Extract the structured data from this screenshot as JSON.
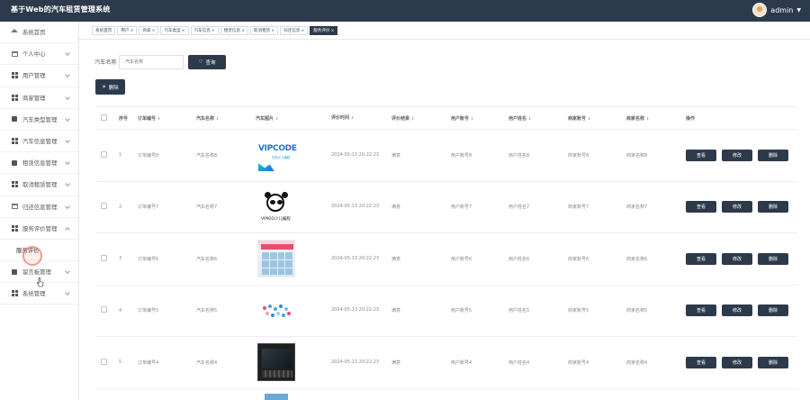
{
  "app": {
    "title": "基于Web的汽车租赁管理系统",
    "user": "admin"
  },
  "sidebar": {
    "items": [
      {
        "label": "系统首页",
        "icon": "home-icon"
      },
      {
        "label": "个人中心",
        "icon": "calendar-icon"
      },
      {
        "label": "用户管理",
        "icon": "grid-icon"
      },
      {
        "label": "商家管理",
        "icon": "grid-icon"
      },
      {
        "label": "汽车类型管理",
        "icon": "bag-icon"
      },
      {
        "label": "汽车信息管理",
        "icon": "grid-icon"
      },
      {
        "label": "租赁信息管理",
        "icon": "car-icon"
      },
      {
        "label": "取消租赁管理",
        "icon": "grid-icon"
      },
      {
        "label": "归还信息管理",
        "icon": "calendar-icon"
      },
      {
        "label": "服务评价管理",
        "icon": "grid-icon"
      },
      {
        "label": "服务评价",
        "icon": ""
      },
      {
        "label": "留言板管理",
        "icon": "bag-icon"
      },
      {
        "label": "系统管理",
        "icon": "grid-icon"
      }
    ]
  },
  "tabs": [
    {
      "label": "系统首页",
      "closable": false
    },
    {
      "label": "用户",
      "closable": true
    },
    {
      "label": "商家",
      "closable": true
    },
    {
      "label": "汽车类型",
      "closable": true
    },
    {
      "label": "汽车信息",
      "closable": true
    },
    {
      "label": "租赁信息",
      "closable": true
    },
    {
      "label": "取消租赁",
      "closable": true
    },
    {
      "label": "归还信息",
      "closable": true
    },
    {
      "label": "服务评价",
      "closable": true
    }
  ],
  "search": {
    "label": "汽车名称",
    "placeholder": "汽车名称",
    "button": "查询"
  },
  "toolbar": {
    "delete_label": "删除"
  },
  "table": {
    "headers": [
      "序号",
      "订单编号",
      "汽车名称",
      "汽车图片",
      "评价时间",
      "评价结果",
      "用户账号",
      "用户姓名",
      "商家账号",
      "商家名称",
      "操作"
    ],
    "actions": {
      "view": "查看",
      "edit": "修改",
      "delete": "删除"
    },
    "rows": [
      {
        "idx": "1",
        "order": "订单编号8",
        "car": "汽车名称8",
        "time": "2024-05-13 20:22:23",
        "result": "满意",
        "uacc": "用户账号8",
        "uname": "用户姓名8",
        "macc": "商家账号8",
        "mname": "商家名称8",
        "image": "vipcode-logo"
      },
      {
        "idx": "2",
        "order": "订单编号7",
        "car": "汽车名称7",
        "time": "2024-05-13 20:22:23",
        "result": "满意",
        "uacc": "用户账号7",
        "uname": "用户姓名7",
        "macc": "商家账号7",
        "mname": "商家名称7",
        "image": "panda-logo"
      },
      {
        "idx": "3",
        "order": "订单编号6",
        "car": "汽车名称6",
        "time": "2024-05-13 20:22:23",
        "result": "满意",
        "uacc": "用户账号6",
        "uname": "用户姓名6",
        "macc": "商家账号6",
        "mname": "商家名称6",
        "image": "book-cover"
      },
      {
        "idx": "4",
        "order": "订单编号5",
        "car": "汽车名称5",
        "time": "2024-05-13 20:22:23",
        "result": "满意",
        "uacc": "用户账号5",
        "uname": "用户姓名5",
        "macc": "商家账号5",
        "mname": "商家名称5",
        "image": "dots-graphic"
      },
      {
        "idx": "5",
        "order": "订单编号4",
        "car": "汽车名称4",
        "time": "2024-05-13 20:22:23",
        "result": "满意",
        "uacc": "用户账号4",
        "uname": "用户姓名4",
        "macc": "商家账号4",
        "mname": "商家名称4",
        "image": "dark-device"
      }
    ]
  },
  "images": {
    "vipcode_text": "VIPCODE",
    "vipcode_sub": "在线少儿编程",
    "panda_text": "VIPKID少儿编程"
  },
  "colors": {
    "header": "#2d3a4b",
    "button": "#2d3a4b",
    "background": "#f0f2f5"
  }
}
